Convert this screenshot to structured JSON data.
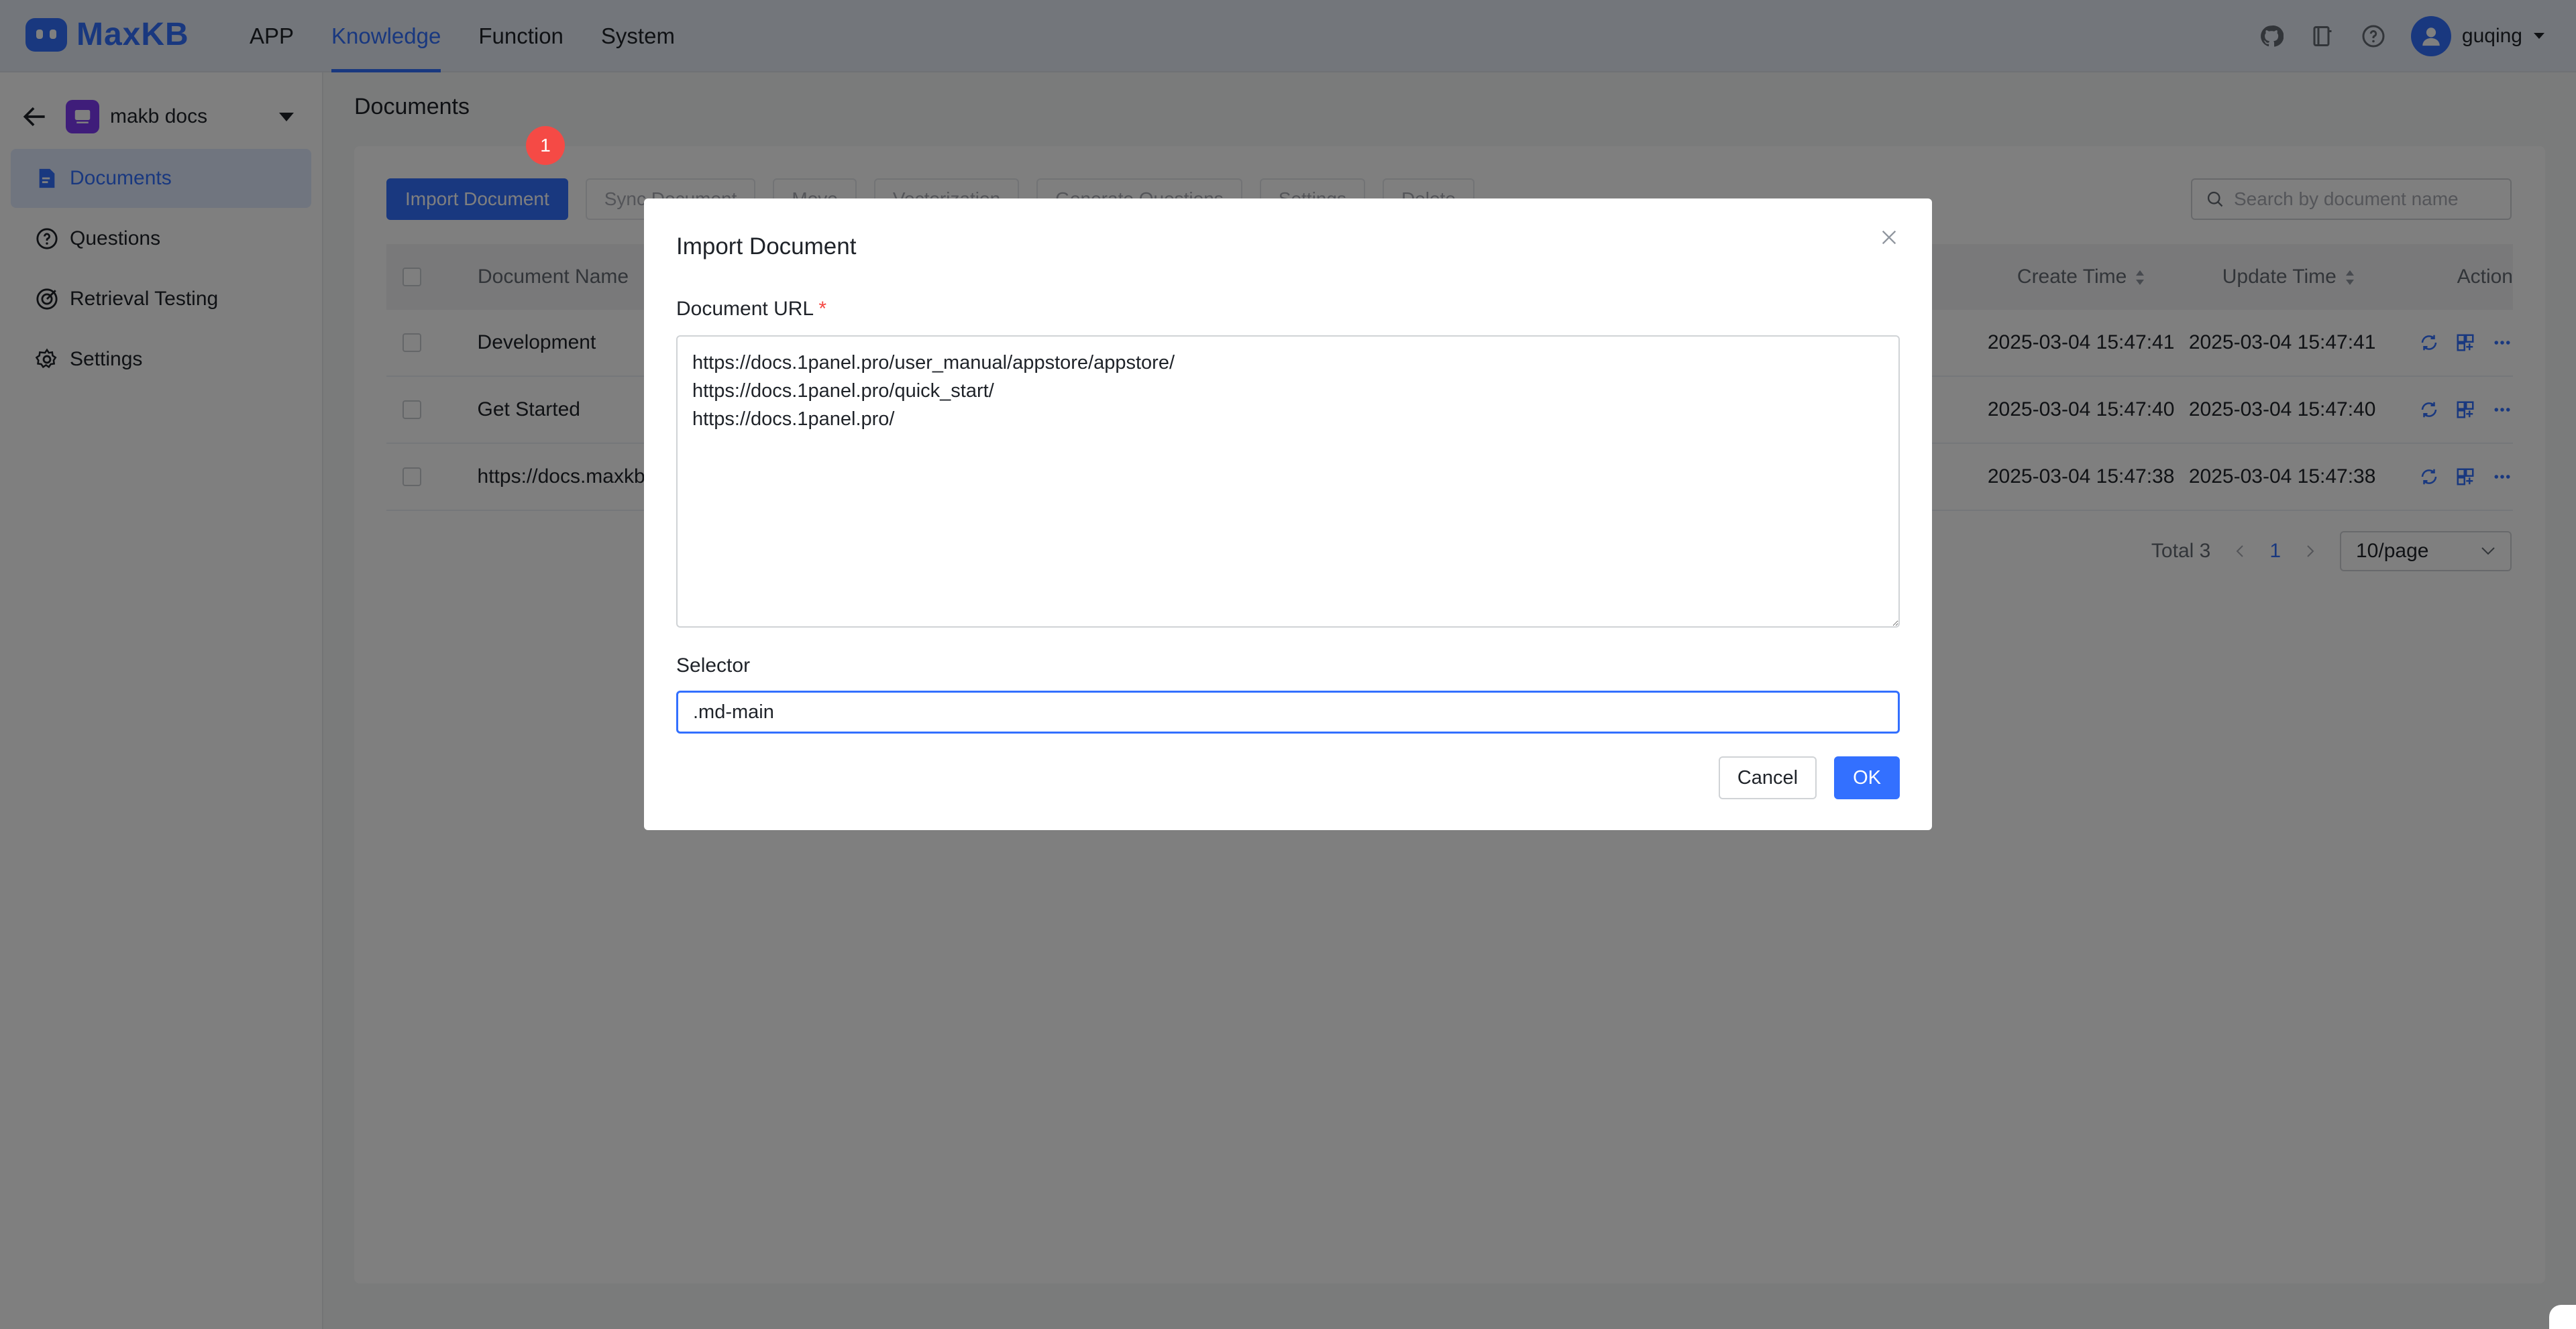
{
  "app": {
    "logo_text": "MaxKB",
    "brand_color": "#3370ff"
  },
  "nav": {
    "items": [
      "APP",
      "Knowledge",
      "Function",
      "System"
    ],
    "active": "Knowledge"
  },
  "top_right": {
    "icons": [
      "github-icon",
      "book-icon",
      "help-icon"
    ],
    "username": "guqing"
  },
  "sidebar": {
    "kb_name": "makb docs",
    "items": [
      {
        "label": "Documents",
        "icon": "document-icon",
        "active": true
      },
      {
        "label": "Questions",
        "icon": "question-icon",
        "active": false
      },
      {
        "label": "Retrieval Testing",
        "icon": "target-icon",
        "active": false
      },
      {
        "label": "Settings",
        "icon": "gear-icon",
        "active": false
      }
    ]
  },
  "main": {
    "title": "Documents",
    "badge": "1",
    "toolbar": {
      "import": "Import Document",
      "sync": "Sync Document",
      "move": "Move",
      "vectorization": "Vectorization",
      "generate": "Generate Questions",
      "settings": "Settings",
      "delete": "Delete"
    },
    "search_placeholder": "Search by document name",
    "table": {
      "headers": {
        "name": "Document Name",
        "create_time": "Create Time",
        "update_time": "Update Time",
        "action": "Action"
      },
      "rows": [
        {
          "name": "Development",
          "create_time": "2025-03-04 15:47:41",
          "update_time": "2025-03-04 15:47:41"
        },
        {
          "name": "Get Started",
          "create_time": "2025-03-04 15:47:40",
          "update_time": "2025-03-04 15:47:40"
        },
        {
          "name": "https://docs.maxkb",
          "create_time": "2025-03-04 15:47:38",
          "update_time": "2025-03-04 15:47:38"
        }
      ]
    },
    "pager": {
      "total": "Total 3",
      "page": "1",
      "page_size": "10/page"
    }
  },
  "dialog": {
    "title": "Import Document",
    "url_label": "Document URL",
    "url_value": "https://docs.1panel.pro/user_manual/appstore/appstore/\nhttps://docs.1panel.pro/quick_start/\nhttps://docs.1panel.pro/",
    "selector_label": "Selector",
    "selector_value": ".md-main",
    "cancel": "Cancel",
    "ok": "OK"
  }
}
